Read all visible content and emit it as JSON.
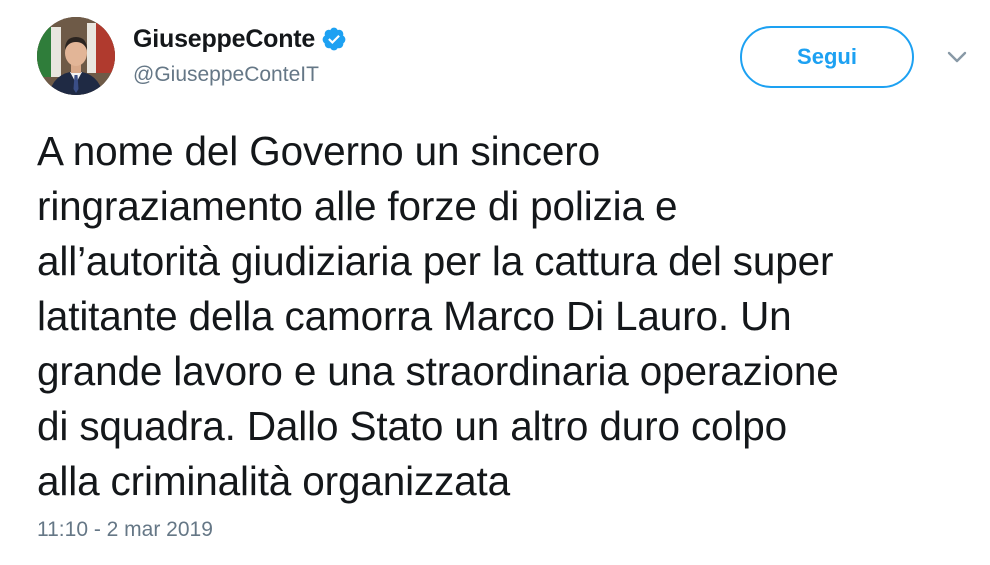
{
  "author": {
    "display_name": "GiuseppeConte",
    "handle": "@GiuseppeConteIT",
    "verified_icon": "verified-badge-icon",
    "avatar": "profile-photo"
  },
  "actions": {
    "follow_label": "Segui",
    "more_icon": "chevron-down-icon"
  },
  "tweet": {
    "lines": [
      "A nome del Governo un sincero",
      "ringraziamento alle forze di polizia e",
      "all’autorità giudiziaria per la cattura del super",
      "latitante della camorra Marco Di Lauro. Un",
      "grande lavoro e una straordinaria operazione",
      "di squadra. Dallo Stato un altro duro colpo",
      "alla criminalità organizzata"
    ],
    "timestamp": "11:10 - 2 mar 2019"
  },
  "colors": {
    "accent": "#1da1f2",
    "text": "#14171a",
    "muted": "#657786"
  }
}
